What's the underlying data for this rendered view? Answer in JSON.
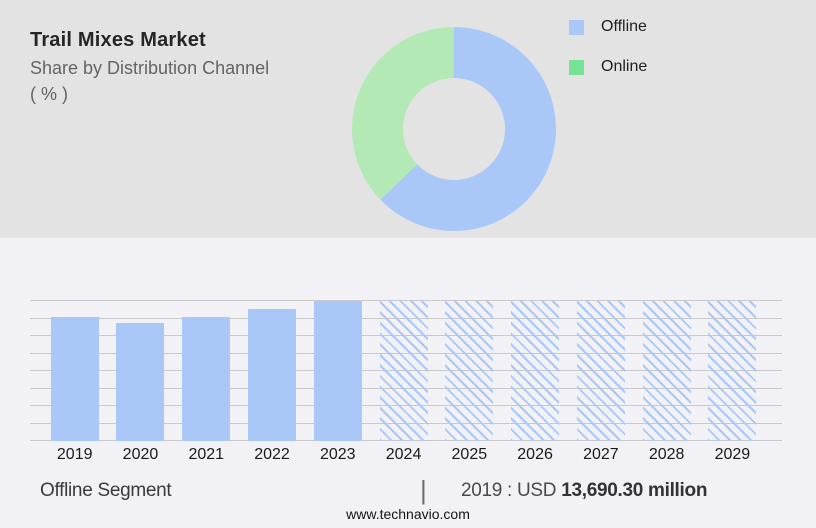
{
  "header": {
    "title": "Trail Mixes Market",
    "subtitle": "Share by Distribution Channel",
    "unit": "( % )"
  },
  "legend": {
    "items": [
      {
        "label": "Offline",
        "color": "#a9c8f8"
      },
      {
        "label": "Online",
        "color": "#75e295"
      }
    ]
  },
  "chart_data": [
    {
      "type": "pie",
      "variant": "donut",
      "title": "Trail Mixes Market - Share by Distribution Channel ( % )",
      "legend_position": "right",
      "start_angle_deg": 0,
      "slices": [
        {
          "label": "Offline",
          "value_pct": 62.8,
          "color": "#a9c8f8"
        },
        {
          "label": "Online",
          "value_pct": 37.2,
          "color": "#b3e9b5"
        }
      ]
    },
    {
      "type": "bar",
      "title": "Offline Segment",
      "categories": [
        "2019",
        "2020",
        "2021",
        "2022",
        "2023",
        "2024",
        "2025",
        "2026",
        "2027",
        "2028",
        "2029"
      ],
      "series": [
        {
          "name": "Offline segment (historic, solid)",
          "style": "solid",
          "color": "#a9c8f8",
          "height_fraction": {
            "2019": 0.886,
            "2020": 0.842,
            "2021": 0.889,
            "2022": 0.943,
            "2023": 1.0
          }
        },
        {
          "name": "Offline segment (forecast, hatched)",
          "style": "hatched",
          "color": "#a9c8f8",
          "height_fraction": {
            "2024": 1.0,
            "2025": 1.0,
            "2026": 1.0,
            "2027": 1.0,
            "2028": 1.0,
            "2029": 1.0
          }
        }
      ],
      "gridlines": 9,
      "grid_color": "#c9c9c9",
      "known_point": {
        "year": "2019",
        "value": "USD 13,690.30 million"
      }
    }
  ],
  "caption": {
    "segment_label": "Offline Segment",
    "separator": "|",
    "value_prefix": "2019 : USD ",
    "value_bold": "13,690.30 million"
  },
  "footer": {
    "website": "www.technavio.com"
  },
  "colors": {
    "top_background": "#e3e3e3",
    "bottom_background": "#f2f2f6",
    "bar_blue": "#a9c8f8",
    "donut_green": "#b3e9b5",
    "legend_green": "#75e295"
  }
}
